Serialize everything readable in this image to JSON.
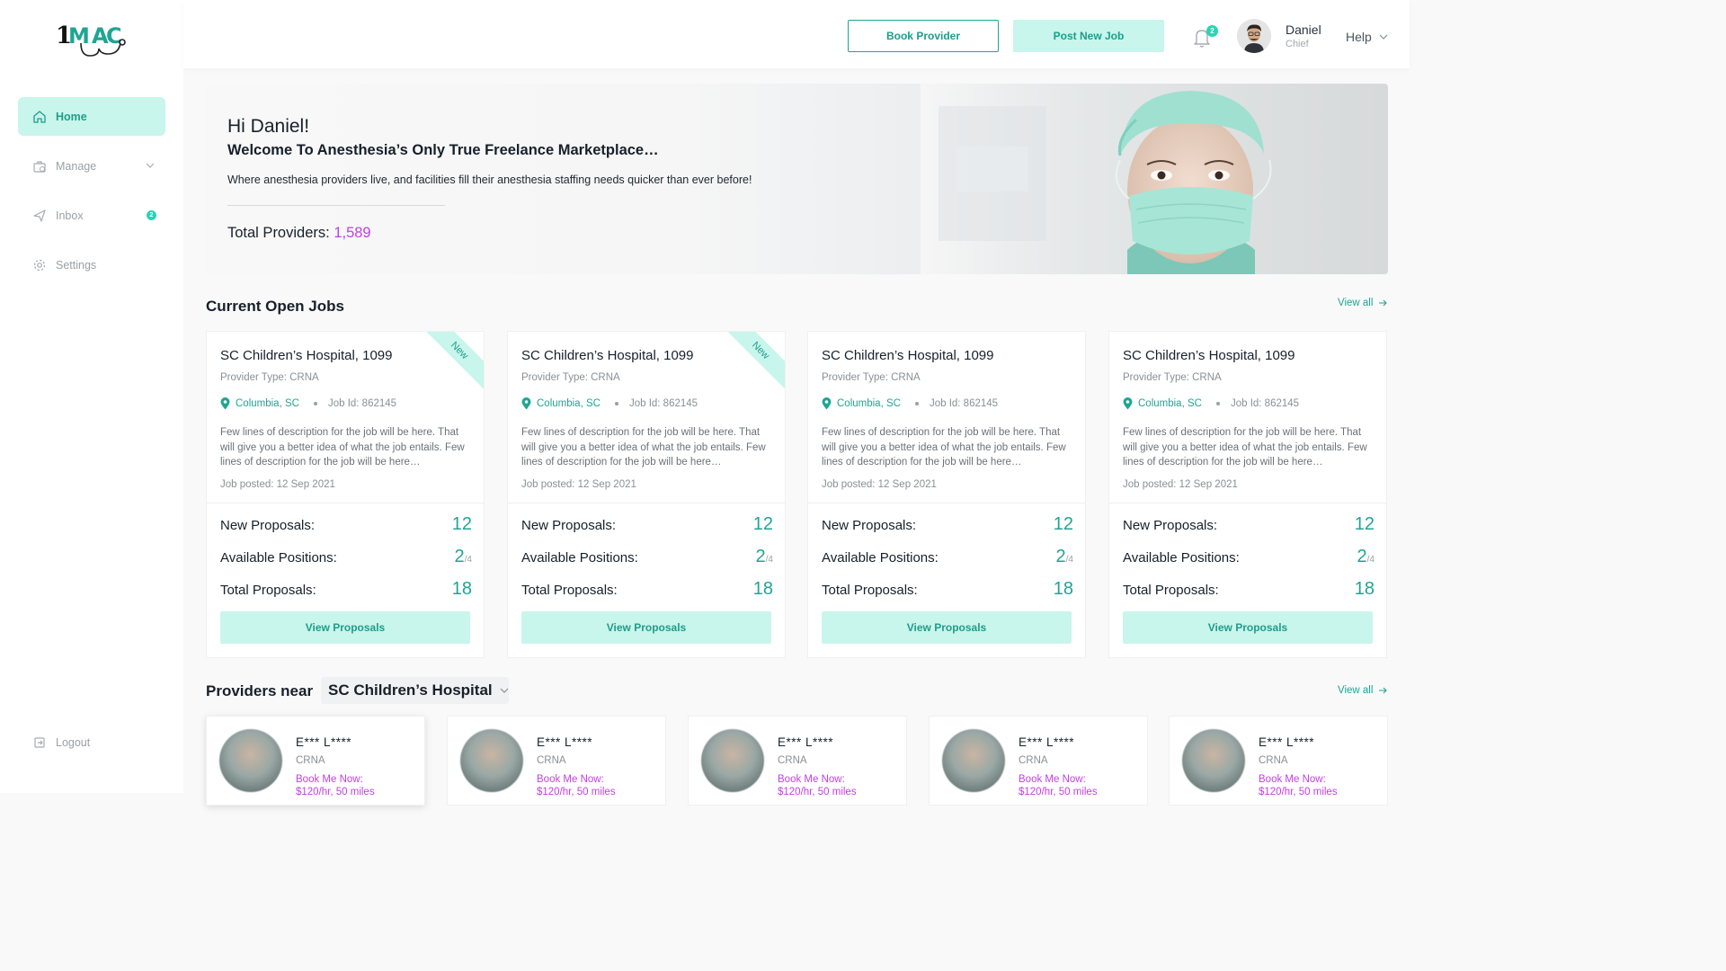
{
  "brand": {
    "logo_text": "1MAC",
    "accent": "#1fa593",
    "accent_light": "#c8f5ec",
    "highlight": "#c43ee6"
  },
  "sidebar": {
    "items": [
      {
        "label": "Home",
        "icon": "home-icon",
        "active": true
      },
      {
        "label": "Manage",
        "icon": "briefcase-icon",
        "has_dropdown": true
      },
      {
        "label": "Inbox",
        "icon": "send-icon",
        "badge": "2"
      },
      {
        "label": "Settings",
        "icon": "gear-icon"
      }
    ],
    "logout_label": "Logout"
  },
  "header": {
    "book_provider_label": "Book Provider",
    "post_job_label": "Post New Job",
    "notification_count": "2",
    "user_name": "Daniel",
    "user_role": "Chief",
    "help_label": "Help"
  },
  "hero": {
    "greeting": "Hi Daniel!",
    "subtitle": "Welcome To Anesthesia’s Only True Freelance Marketplace…",
    "description": "Where anesthesia providers live, and facilities fill their anesthesia staffing needs quicker than ever before!",
    "total_label": "Total Providers:",
    "total_value": "1,589"
  },
  "jobs_section": {
    "title": "Current Open Jobs",
    "view_all": "View all",
    "jobs": [
      {
        "title": "SC Children’s Hospital, 1099",
        "provider_type": "Provider Type: CRNA",
        "location": "Columbia, SC",
        "job_id": "Job Id: 862145",
        "description": "Few lines of description for the job will be here. That will give you a better idea of what the job entails. Few lines of description for the job will be here…",
        "posted": "Job posted: 12 Sep 2021",
        "new_label": "New",
        "is_new": true,
        "new_proposals_label": "New Proposals:",
        "new_proposals": "12",
        "available_label": "Available Positions:",
        "available": "2",
        "available_total": "/4",
        "total_label": "Total Proposals:",
        "total": "18",
        "button": "View Proposals"
      },
      {
        "title": "SC Children’s Hospital, 1099",
        "provider_type": "Provider Type: CRNA",
        "location": "Columbia, SC",
        "job_id": "Job Id: 862145",
        "description": "Few lines of description for the job will be here. That will give you a better idea of what the job entails. Few lines of description for the job will be here…",
        "posted": "Job posted: 12 Sep 2021",
        "new_label": "New",
        "is_new": true,
        "new_proposals_label": "New Proposals:",
        "new_proposals": "12",
        "available_label": "Available Positions:",
        "available": "2",
        "available_total": "/4",
        "total_label": "Total Proposals:",
        "total": "18",
        "button": "View Proposals"
      },
      {
        "title": "SC Children’s Hospital, 1099",
        "provider_type": "Provider Type: CRNA",
        "location": "Columbia, SC",
        "job_id": "Job Id: 862145",
        "description": "Few lines of description for the job will be here. That will give you a better idea of what the job entails. Few lines of description for the job will be here…",
        "posted": "Job posted: 12 Sep 2021",
        "is_new": false,
        "new_proposals_label": "New Proposals:",
        "new_proposals": "12",
        "available_label": "Available Positions:",
        "available": "2",
        "available_total": "/4",
        "total_label": "Total Proposals:",
        "total": "18",
        "button": "View Proposals"
      },
      {
        "title": "SC Children’s Hospital, 1099",
        "provider_type": "Provider Type: CRNA",
        "location": "Columbia, SC",
        "job_id": "Job Id: 862145",
        "description": "Few lines of description for the job will be here. That will give you a better idea of what the job entails. Few lines of description for the job will be here…",
        "posted": "Job posted: 12 Sep 2021",
        "is_new": false,
        "new_proposals_label": "New Proposals:",
        "new_proposals": "12",
        "available_label": "Available Positions:",
        "available": "2",
        "available_total": "/4",
        "total_label": "Total Proposals:",
        "total": "18",
        "button": "View Proposals"
      }
    ]
  },
  "providers_section": {
    "title": "Providers near",
    "selected_facility": "SC Children’s Hospital",
    "view_all": "View all",
    "providers": [
      {
        "name": "E*** L****",
        "type": "CRNA",
        "book_label": "Book Me Now:",
        "rate": "$120/hr, 50 miles"
      },
      {
        "name": "E*** L****",
        "type": "CRNA",
        "book_label": "Book Me Now:",
        "rate": "$120/hr, 50 miles"
      },
      {
        "name": "E*** L****",
        "type": "CRNA",
        "book_label": "Book Me Now:",
        "rate": "$120/hr, 50 miles"
      },
      {
        "name": "E*** L****",
        "type": "CRNA",
        "book_label": "Book Me Now:",
        "rate": "$120/hr, 50 miles"
      },
      {
        "name": "E*** L****",
        "type": "CRNA",
        "book_label": "Book Me Now:",
        "rate": "$120/hr, 50 miles"
      }
    ]
  }
}
